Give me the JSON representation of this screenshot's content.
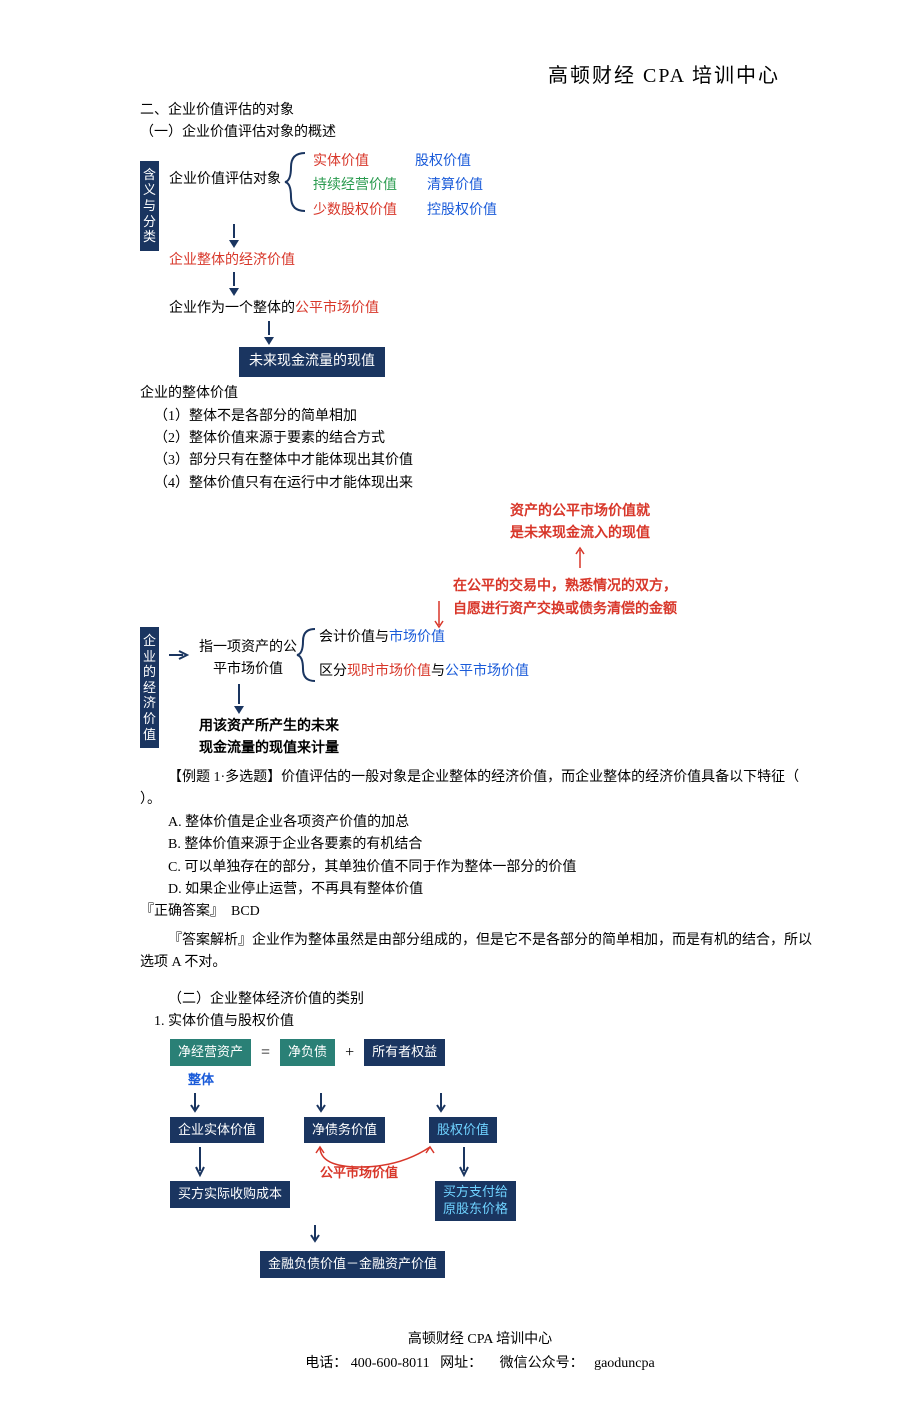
{
  "header": {
    "title": "高顿财经  CPA 培训中心"
  },
  "s1": {
    "h2": "二、企业价值评估的对象",
    "h2a": "（一）企业价值评估对象的概述"
  },
  "diag1": {
    "vlabel": [
      "含",
      "义",
      "与",
      "分",
      "类"
    ],
    "n1": "企业价值评估对象",
    "b1a": "实体价值",
    "b1b": "股权价值",
    "b2a": "持续经营价值",
    "b2b": "清算价值",
    "b3a": "少数股权价值",
    "b3b": "控股权价值",
    "n2": "企业整体的经济价值",
    "n3": "企业作为一个整体的公平市场价值",
    "n4": "未来现金流量的现值"
  },
  "list1": {
    "title": "企业的整体价值",
    "i1": "（1）整体不是各部分的简单相加",
    "i2": "（2）整体价值来源于要素的结合方式",
    "i3": "（3）部分只有在整体中才能体现出其价值",
    "i4": "（4）整体价值只有在运行中才能体现出来"
  },
  "diag2": {
    "top1": "资产的公平市场价值就",
    "top2": "是未来现金流入的现值",
    "mid1": "在公平的交易中，熟悉情况的双方，",
    "mid2": "自愿进行资产交换或债务清偿的金额",
    "vlabel": [
      "企",
      "业",
      "的",
      "经",
      "济",
      "价",
      "值"
    ],
    "c1a": "指一项资产的公",
    "c1b": "平市场价值",
    "r1a": "会计价值与",
    "r1b": "市场价值",
    "r2a": "区分",
    "r2b": "现时市场价值",
    "r2c": "与",
    "r2d": "公平市场价值",
    "bot1": "用该资产所产生的未来",
    "bot2": "现金流量的现值来计量"
  },
  "q1": {
    "stem": "【例题 1·多选题】价值评估的一般对象是企业整体的经济价值，而企业整体的经济价值具备以下特征（  ）。",
    "a": "A. 整体价值是企业各项资产价值的加总",
    "b": "B. 整体价值来源于企业各要素的有机结合",
    "c": "C. 可以单独存在的部分，其单独价值不同于作为整体一部分的价值",
    "d": "D. 如果企业停止运营，不再具有整体价值",
    "ansLabel": "『正确答案』",
    "ans": "BCD",
    "expLabel": "『答案解析』",
    "exp": "企业作为整体虽然是由部分组成的，但是它不是各部分的简单相加，而是有机的结合，所以选项 A 不对。"
  },
  "s2": {
    "h": "（二）企业整体经济价值的类别",
    "s1": "1. 实体价值与股权价值"
  },
  "diag3": {
    "r1a": "净经营资产",
    "eq": "=",
    "r1b": "净负债",
    "plus": "+",
    "r1c": "所有者权益",
    "lbl1": "整体",
    "r2a": "企业实体价值",
    "r2b": "净债务价值",
    "r2c": "股权价值",
    "fm": "公平市场价值",
    "r3a": "买方实际收购成本",
    "r3b": "买方支付给",
    "r3b2": "原股东价格",
    "r4": "金融负债价值－金融资产价值"
  },
  "footer": {
    "l1": "高顿财经 CPA 培训中心",
    "l2a": "电话：",
    "l2b": "400-600-8011",
    "l2c": "网址：",
    "l2d": "微信公众号：",
    "l2e": "gaoduncpa"
  }
}
